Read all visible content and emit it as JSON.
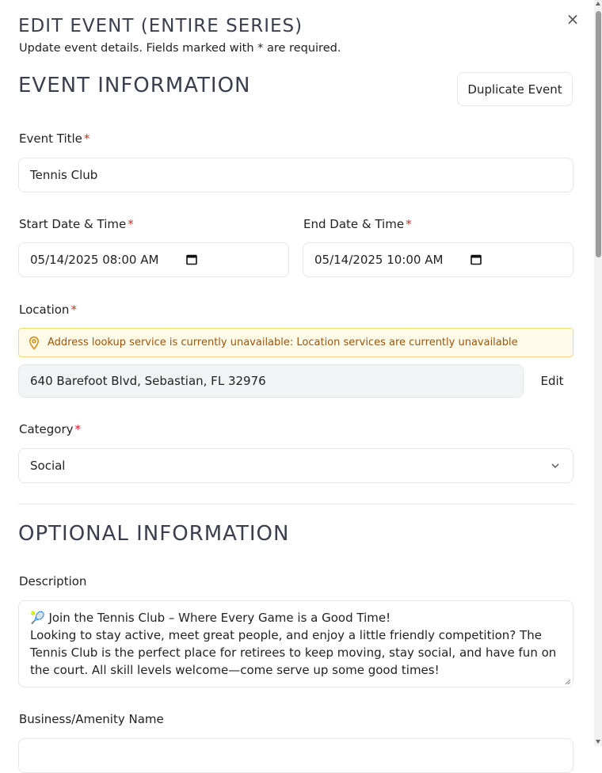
{
  "modal": {
    "title": "EDIT EVENT (ENTIRE SERIES)",
    "subtitle": "Update event details. Fields marked with * are required.",
    "close_glyph": "×"
  },
  "event_info": {
    "title": "EVENT INFORMATION",
    "duplicate_label": "Duplicate Event"
  },
  "fields": {
    "required_mark": "*",
    "event_title": {
      "label": "Event Title",
      "value": "Tennis Club"
    },
    "start": {
      "label": "Start Date & Time",
      "value": "05/14/2025 08:00 AM"
    },
    "end": {
      "label": "End Date & Time",
      "value": "05/14/2025 10:00 AM"
    },
    "location": {
      "label": "Location",
      "warning": "Address lookup service is currently unavailable: Location services are currently unavailable",
      "value": "640 Barefoot Blvd, Sebastian, FL 32976",
      "edit_label": "Edit"
    },
    "category": {
      "label": "Category",
      "value": "Social"
    }
  },
  "optional_info": {
    "title": "OPTIONAL INFORMATION",
    "description_label": "Description",
    "description_line1": "🎾 Join the Tennis Club – Where Every Game is a Good Time!",
    "description_line2": "Looking to stay active, meet great people, and enjoy a little friendly competition? The Tennis Club is the perfect place for retirees to keep moving, stay social, and have fun on the court. All skill levels welcome—come serve up some good times!",
    "business_label": "Business/Amenity Name"
  },
  "colors": {
    "required": "#dc2626",
    "warning_bg": "#fefbe8",
    "warning_text": "#a0530a"
  },
  "icons": {
    "close": "close-icon",
    "calendar": "calendar-icon",
    "location": "map-pin-icon",
    "chevron": "chevron-down-icon"
  }
}
